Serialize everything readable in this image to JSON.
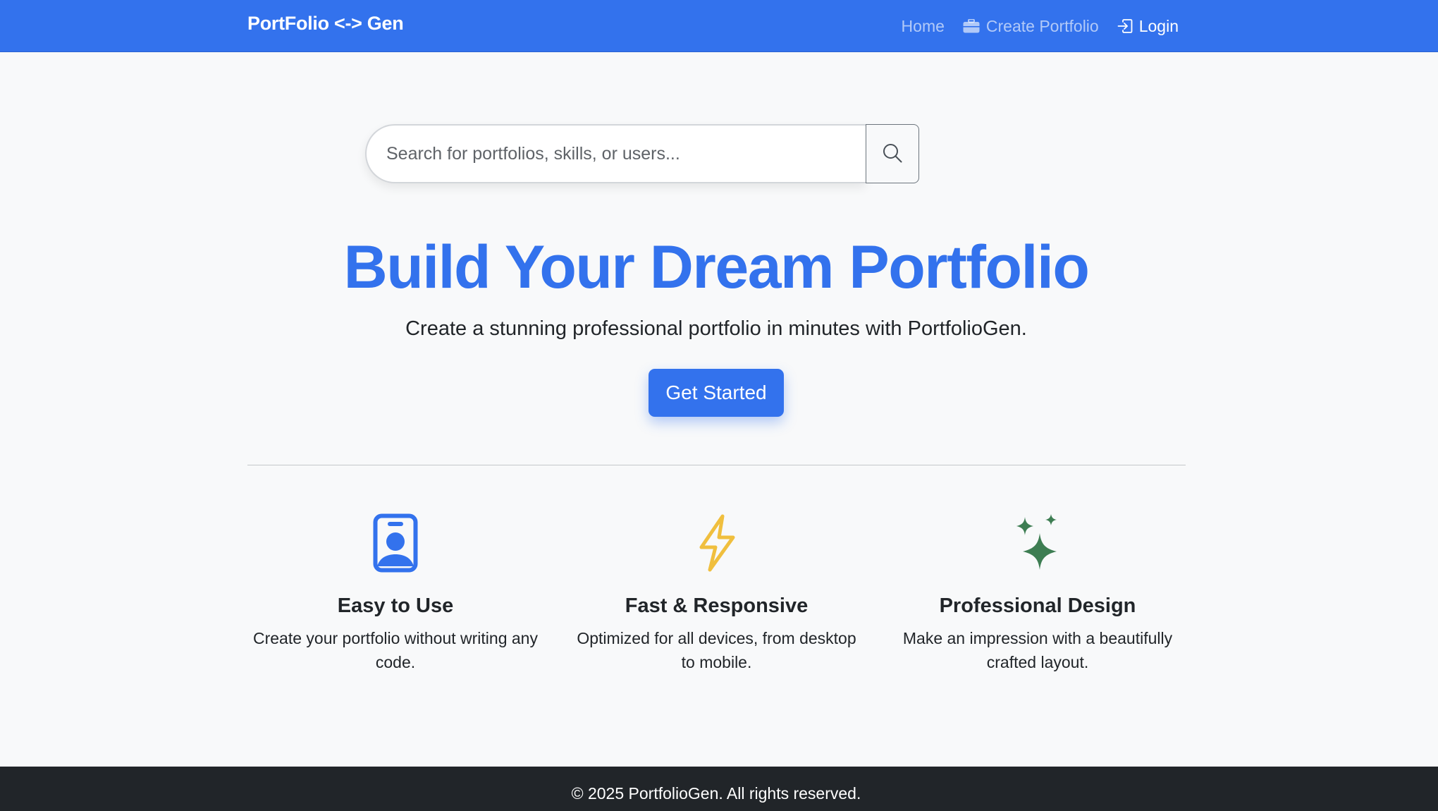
{
  "navbar": {
    "brand": "PortFolio <-> Gen",
    "links": [
      {
        "label": "Home",
        "icon": "none"
      },
      {
        "label": "Create Portfolio",
        "icon": "briefcase-icon"
      },
      {
        "label": "Login",
        "icon": "login-icon"
      }
    ]
  },
  "search": {
    "placeholder": "Search for portfolios, skills, or users...",
    "button_icon": "search-icon"
  },
  "hero": {
    "title": "Build Your Dream Portfolio",
    "subtitle": "Create a stunning professional portfolio in minutes with PortfolioGen.",
    "cta_label": "Get Started"
  },
  "features": [
    {
      "icon": "person-badge-icon",
      "title": "Easy to Use",
      "text": "Create your portfolio without writing any code."
    },
    {
      "icon": "lightning-icon",
      "title": "Fast & Responsive",
      "text": "Optimized for all devices, from desktop to mobile."
    },
    {
      "icon": "sparkles-icon",
      "title": "Professional Design",
      "text": "Make an impression with a beautifully crafted layout."
    }
  ],
  "footer": {
    "text": "© 2025 PortfolioGen. All rights reserved."
  },
  "colors": {
    "primary": "#3372ed",
    "warning": "#f0bf3e",
    "success": "#3d7d52",
    "footer_bg": "#212529"
  }
}
